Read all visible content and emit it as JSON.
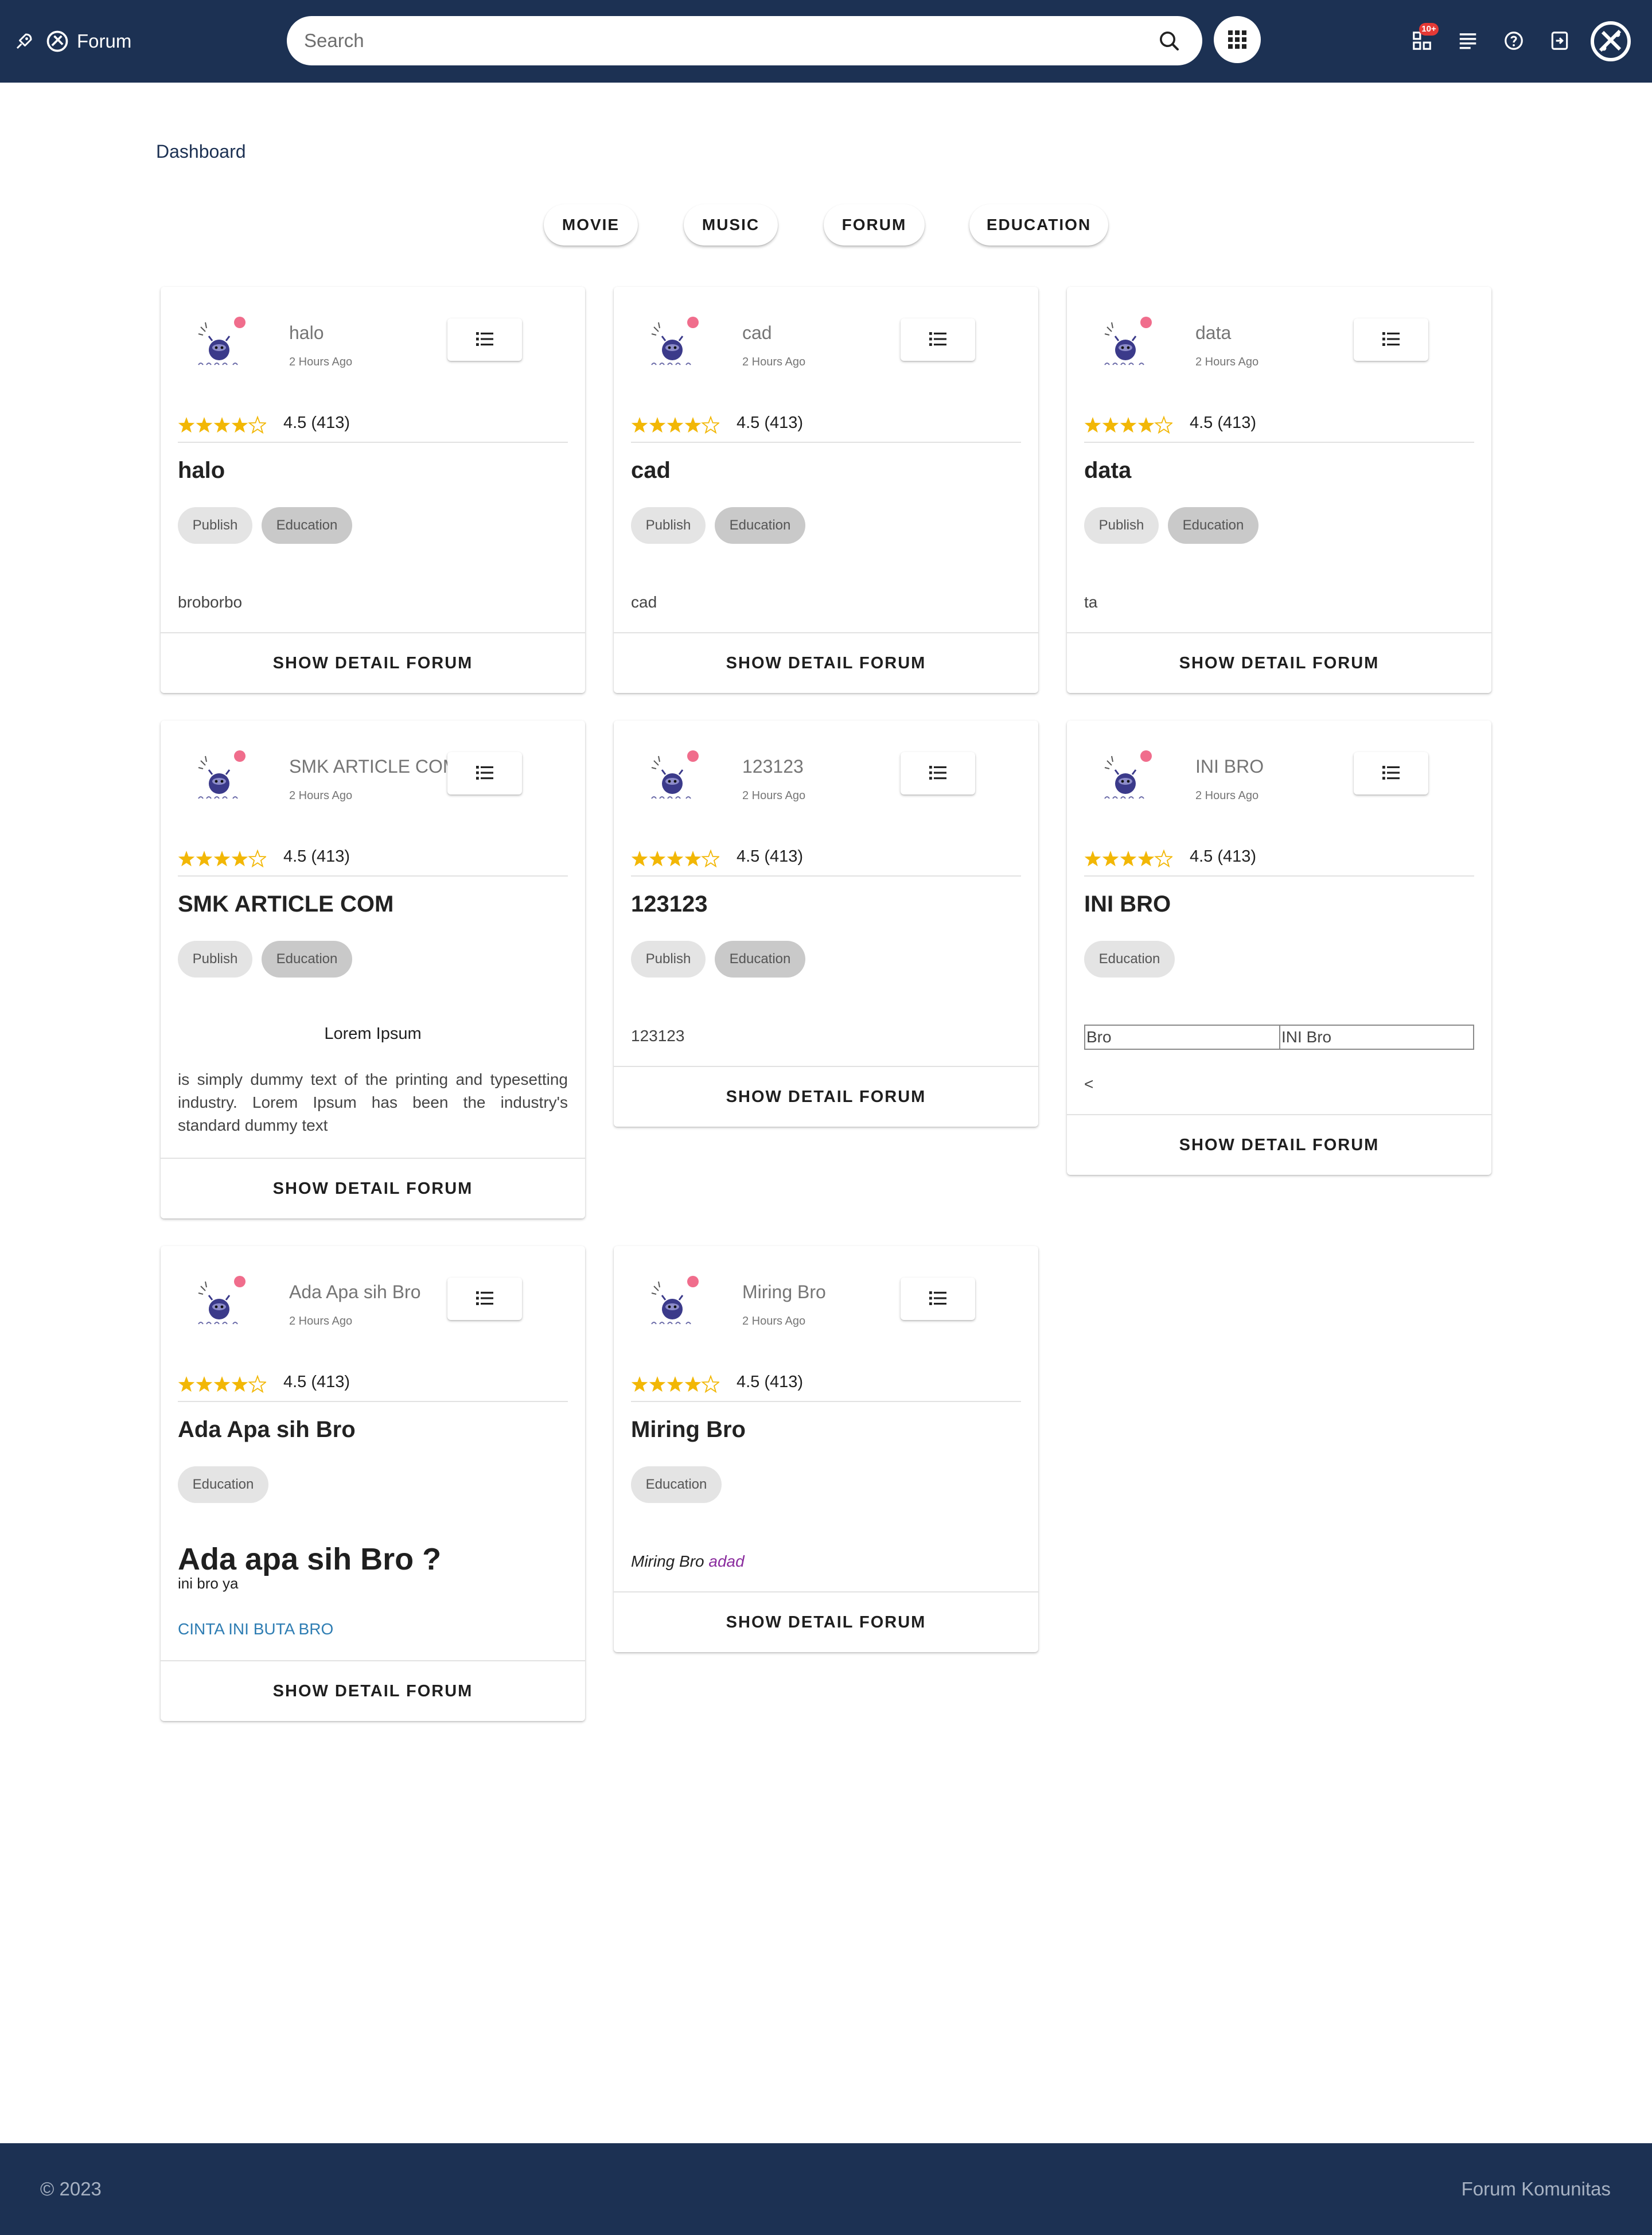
{
  "header": {
    "app_title": "Forum",
    "search_placeholder": "Search",
    "notification_badge": "10+"
  },
  "breadcrumb": "Dashboard",
  "categories": [
    "MOVIE",
    "MUSIC",
    "FORUM",
    "EDUCATION"
  ],
  "colors": {
    "navbar": "#1c3153",
    "star": "#f2b705",
    "avatar_dot": "#f06d8c",
    "link_blue": "#2e7db3",
    "link_purple": "#8a2c9e"
  },
  "cards": [
    {
      "user": "halo",
      "time": "2 Hours Ago",
      "rating_text": "4.5 (413)",
      "rating": 4.5,
      "title": "halo",
      "tags": [
        "Publish",
        "Education"
      ],
      "body": "broborbo",
      "action": "SHOW DETAIL FORUM"
    },
    {
      "user": "cad",
      "time": "2 Hours Ago",
      "rating_text": "4.5 (413)",
      "rating": 4.5,
      "title": "cad",
      "tags": [
        "Publish",
        "Education"
      ],
      "body": "cad",
      "action": "SHOW DETAIL FORUM"
    },
    {
      "user": "data",
      "time": "2 Hours Ago",
      "rating_text": "4.5 (413)",
      "rating": 4.5,
      "title": "data",
      "tags": [
        "Publish",
        "Education"
      ],
      "body": "ta",
      "action": "SHOW DETAIL FORUM"
    },
    {
      "user": "SMK ARTICLE COM",
      "time": "2 Hours Ago",
      "rating_text": "4.5 (413)",
      "rating": 4.5,
      "title": "SMK ARTICLE COM",
      "tags": [
        "Publish",
        "Education"
      ],
      "body_heading": "Lorem Ipsum",
      "body": "is simply dummy text of the printing and typesetting industry. Lorem Ipsum has been the industry's standard dummy text",
      "action": "SHOW DETAIL FORUM"
    },
    {
      "user": "123123",
      "time": "2 Hours Ago",
      "rating_text": "4.5 (413)",
      "rating": 4.5,
      "title": "123123",
      "tags": [
        "Publish",
        "Education"
      ],
      "body": "123123",
      "action": "SHOW DETAIL FORUM"
    },
    {
      "user": "INI BRO",
      "time": "2 Hours Ago",
      "rating_text": "4.5 (413)",
      "rating": 4.5,
      "title": "INI BRO",
      "tags": [
        "Education"
      ],
      "table_cells": [
        "Bro",
        "INI Bro"
      ],
      "body": "<",
      "action": "SHOW DETAIL FORUM"
    },
    {
      "user": "Ada Apa sih Bro",
      "time": "2 Hours Ago",
      "rating_text": "4.5 (413)",
      "rating": 4.5,
      "title": "Ada Apa sih Bro",
      "tags": [
        "Education"
      ],
      "body_heading": "Ada apa sih Bro ?",
      "body": "ini bro ya",
      "link": "CINTA INI BUTA BRO",
      "action": "SHOW DETAIL FORUM"
    },
    {
      "user": "Miring Bro",
      "time": "2 Hours Ago",
      "rating_text": "4.5 (413)",
      "rating": 4.5,
      "title": "Miring Bro",
      "tags": [
        "Education"
      ],
      "body": "Miring Bro",
      "link": "adad",
      "action": "SHOW DETAIL FORUM"
    }
  ],
  "footer": {
    "copyright": "© 2023",
    "brand": "Forum Komunitas"
  }
}
